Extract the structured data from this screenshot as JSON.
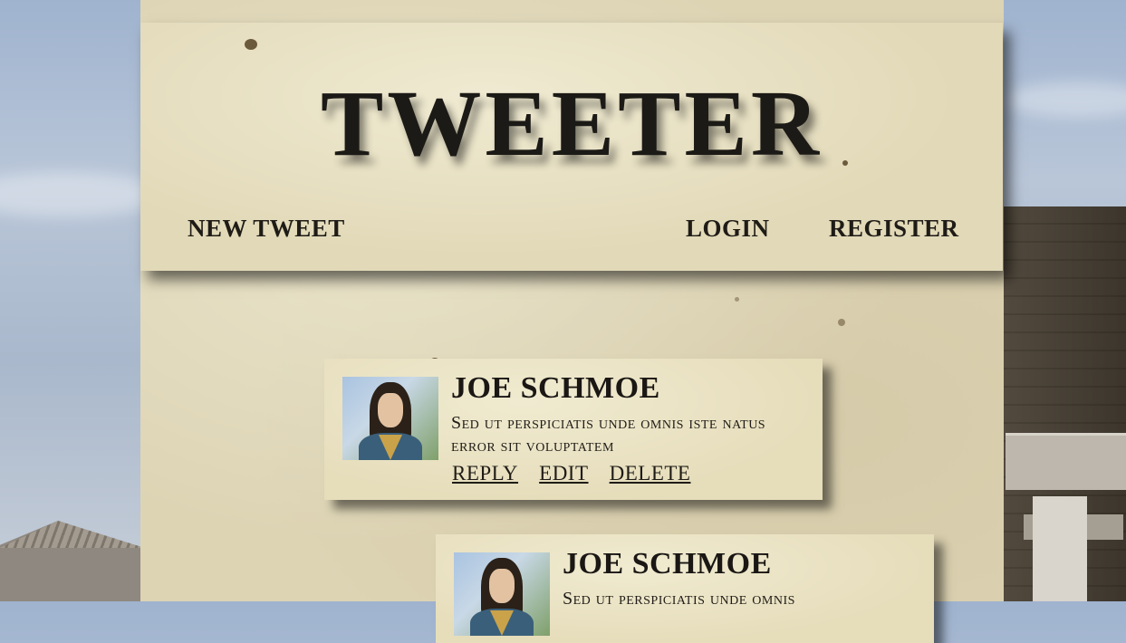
{
  "header": {
    "title": "TWEETER",
    "nav": {
      "new_tweet": "NEW TWEET",
      "login": "LOGIN",
      "register": "REGISTER"
    }
  },
  "tweets": [
    {
      "author": "JOE SCHMOE",
      "text": "Sed ut perspiciatis unde omnis iste natus error sit voluptatem",
      "actions": {
        "reply": "REPLY",
        "edit": "EDIT",
        "delete": "DELETE"
      }
    },
    {
      "author": "JOE SCHMOE",
      "text": "Sed ut perspiciatis unde omnis"
    }
  ],
  "colors": {
    "parchment": "#e2d9b8",
    "ink": "#1c1a16",
    "sky": "#9fb3cf"
  }
}
